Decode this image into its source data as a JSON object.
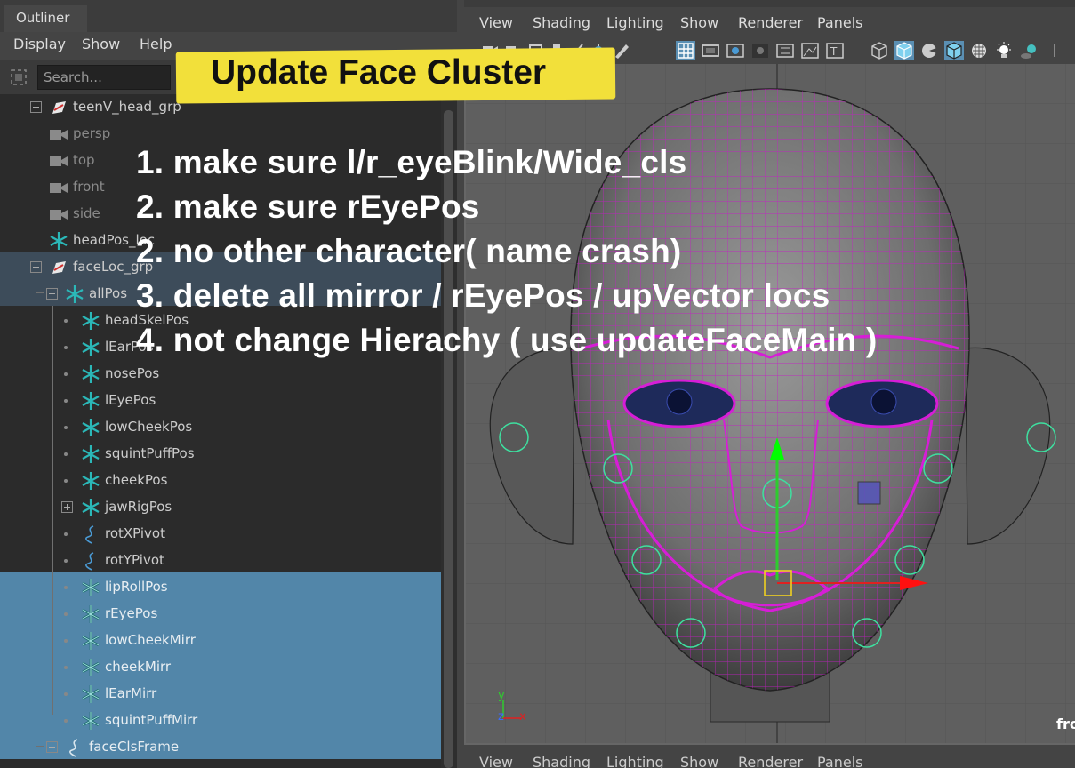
{
  "outliner": {
    "tab_label": "Outliner",
    "menu": [
      "Display",
      "Show",
      "Help"
    ],
    "search_placeholder": "Search...",
    "rows": [
      {
        "label": "teenV_head_grp",
        "icon": "transform-group-icon"
      },
      {
        "label": "persp",
        "icon": "camera-icon"
      },
      {
        "label": "top",
        "icon": "camera-icon"
      },
      {
        "label": "front",
        "icon": "camera-icon"
      },
      {
        "label": "side",
        "icon": "camera-icon"
      },
      {
        "label": "headPos_loc",
        "icon": "locator-icon"
      },
      {
        "label": "faceLoc_grp",
        "icon": "transform-group-icon"
      },
      {
        "label": "allPos",
        "icon": "locator-icon"
      },
      {
        "label": "headSkelPos",
        "icon": "locator-icon"
      },
      {
        "label": "lEarPos",
        "icon": "locator-icon"
      },
      {
        "label": "nosePos",
        "icon": "locator-icon"
      },
      {
        "label": "lEyePos",
        "icon": "locator-icon"
      },
      {
        "label": "lowCheekPos",
        "icon": "locator-icon"
      },
      {
        "label": "squintPuffPos",
        "icon": "locator-icon"
      },
      {
        "label": "cheekPos",
        "icon": "locator-icon"
      },
      {
        "label": "jawRigPos",
        "icon": "locator-icon"
      },
      {
        "label": "rotXPivot",
        "icon": "curve-icon"
      },
      {
        "label": "rotYPivot",
        "icon": "curve-icon"
      },
      {
        "label": "lipRollPos",
        "icon": "locator-icon"
      },
      {
        "label": "rEyePos",
        "icon": "locator-icon"
      },
      {
        "label": "lowCheekMirr",
        "icon": "locator-icon"
      },
      {
        "label": "cheekMirr",
        "icon": "locator-icon"
      },
      {
        "label": "lEarMirr",
        "icon": "locator-icon"
      },
      {
        "label": "squintPuffMirr",
        "icon": "locator-icon"
      },
      {
        "label": "faceClsFrame",
        "icon": "curve-icon"
      }
    ]
  },
  "viewport": {
    "menu": [
      "View",
      "Shading",
      "Lighting",
      "Show",
      "Renderer",
      "Panels"
    ],
    "camera_label": "fro",
    "axis_labels": {
      "y": "y",
      "z": "z",
      "x": "x"
    }
  },
  "annotation": {
    "title": "Update Face Cluster",
    "lines": [
      "1. make sure l/r_eyeBlink/Wide_cls",
      "2. make sure rEyePos",
      "2. no other character( name crash)",
      "3. delete all mirror / rEyePos / upVector locs",
      "4. not change Hierachy ( use updateFaceMain )"
    ]
  },
  "colors": {
    "selection": "#5286a9",
    "wireframe": "#d61ed6",
    "locator": "#2bb8b8",
    "banner": "#f2e03a"
  }
}
